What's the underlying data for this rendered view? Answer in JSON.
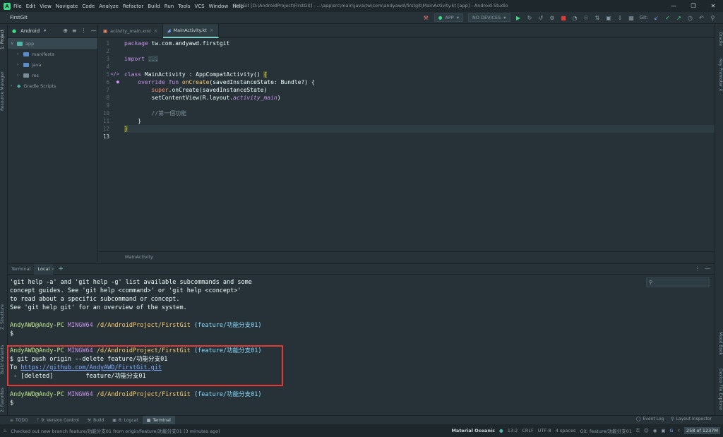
{
  "titlebar": {
    "menu": [
      "File",
      "Edit",
      "View",
      "Navigate",
      "Code",
      "Analyze",
      "Refactor",
      "Build",
      "Run",
      "Tools",
      "VCS",
      "Window",
      "Help"
    ],
    "window_title": "FirstGit [D:\\AndroidProject\\FirstGit] - ...\\app\\src\\main\\java\\tw\\com\\andyawd\\firstgit\\MainActivity.kt [app] - Android Studio"
  },
  "navbar": {
    "project": "FirstGit",
    "run_config": "APP",
    "device": "NO DEVICES",
    "git_label": "Git:"
  },
  "project_panel": {
    "view_mode": "Android",
    "tree": [
      {
        "label": "app",
        "level": 0,
        "icon": "folder-teal",
        "selected": true
      },
      {
        "label": "manifests",
        "level": 1,
        "icon": "folder-blue",
        "selected": false
      },
      {
        "label": "java",
        "level": 1,
        "icon": "folder-blue",
        "selected": false
      },
      {
        "label": "res",
        "level": 1,
        "icon": "folder-gray",
        "selected": false
      },
      {
        "label": "Gradle Scripts",
        "level": 0,
        "icon": "gradle",
        "selected": false
      }
    ]
  },
  "left_stripe": {
    "project": "1: Project",
    "resource_manager": "Resource Manager",
    "structure": "Z: Structure",
    "build_variants": "Build Variants",
    "favorites": "2: Favorites"
  },
  "right_stripe": {
    "gradle": "Gradle",
    "key_promoter": "Key Promoter X",
    "mood_book": "Mood Book",
    "device_file_explorer": "Device File Explorer"
  },
  "editor": {
    "tabs": [
      {
        "label": "activity_main.xml",
        "active": false
      },
      {
        "label": "MainActivity.kt",
        "active": true
      }
    ],
    "line_numbers": [
      "1",
      "2",
      "3",
      "4",
      "5",
      "6",
      "7",
      "8",
      "9",
      "10",
      "11",
      "12",
      "13"
    ],
    "current_line": "13",
    "code": {
      "l1_kw": "package",
      "l1_rest": " tw.com.andyawd.firstgit",
      "l3_kw": "import",
      "l3_fold": "...",
      "l6_kw": "class",
      "l6_rest": " MainActivity : AppCompatActivity() ",
      "l6_brace": "{",
      "l7_kw": "override fun",
      "l7_fn": "onCreate",
      "l7_rest": "(savedInstanceState: Bundle?) {",
      "l8_kw": "super",
      "l8_rest": ".onCreate(savedInstanceState)",
      "l9_pre": "setContentView(R.layout.",
      "l9_it": "activity_main",
      "l9_post": ")",
      "l11_comment": "//第一個功能",
      "l12": "}",
      "l13": "}"
    },
    "breadcrumb": "MainActivity"
  },
  "terminal": {
    "tabs": [
      {
        "label": "Terminal",
        "active": false
      },
      {
        "label": "Local",
        "active": true
      }
    ],
    "add_tab": "+",
    "help_lines": [
      "'git help -a' and 'git help -g' list available subcommands and some",
      "concept guides. See 'git help <command>' or 'git help <concept>'",
      "to read about a specific subcommand or concept.",
      "See 'git help git' for an overview of the system."
    ],
    "prompt_user": "AndyAWD@Andy-PC",
    "prompt_env": "MINGW64",
    "prompt_path": "/d/AndroidProject/FirstGit",
    "prompt_branch": "(feature/功能分支01)",
    "dollar": "$",
    "command": "$ git push origin --delete feature/功能分支01",
    "to_prefix": "To ",
    "remote_url": "https://github.com/AndyAWD/FirstGit.git",
    "deleted_line": " - [deleted]         feature/功能分支01"
  },
  "bottom_tools": [
    {
      "label": "TODO",
      "active": false
    },
    {
      "label": "9: Version Control",
      "active": false
    },
    {
      "label": "Build",
      "active": false
    },
    {
      "label": "6: Logcat",
      "active": false
    },
    {
      "label": "Terminal",
      "active": true
    }
  ],
  "bottom_right_tools": [
    "Event Log",
    "Layout Inspector"
  ],
  "statusbar": {
    "message": "Checked out new branch feature/功能分支01 from origin/feature/功能分支01 (3 minutes ago)",
    "theme": "Material Oceanic",
    "position": "13:2",
    "line_sep": "CRLF",
    "encoding": "UTF-8",
    "indent": "4 spaces",
    "git_branch": "Git: feature/功能分支01",
    "memory": "258 of 1237M"
  }
}
